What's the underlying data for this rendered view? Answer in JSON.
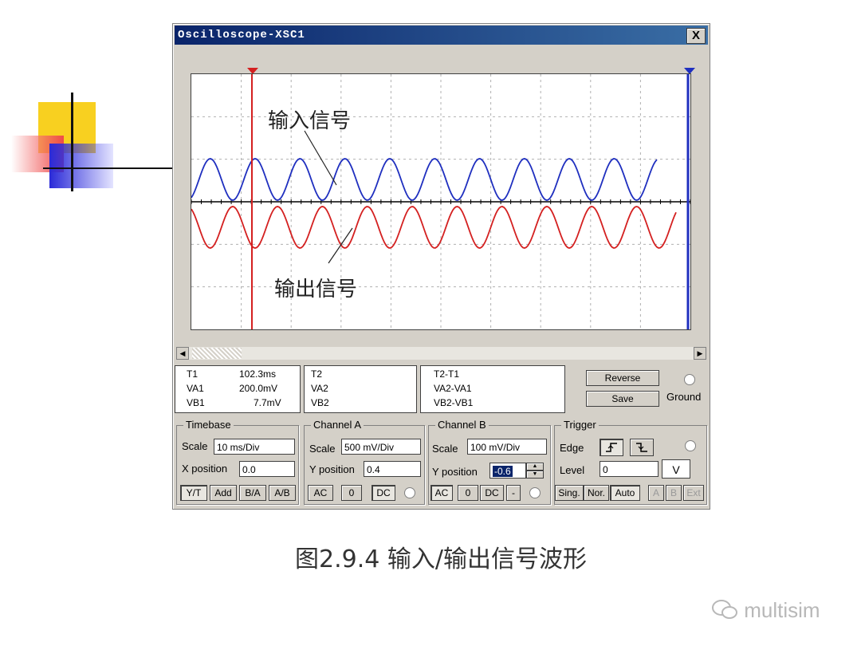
{
  "window": {
    "title": "Oscilloscope-XSC1",
    "close_label": "X"
  },
  "annotations": {
    "input": "输入信号",
    "output": "输出信号"
  },
  "cursor": {
    "t1_label": "T1",
    "va1_label": "VA1",
    "vb1_label": "VB1",
    "t1_value": "102.3ms",
    "va1_value": "200.0mV",
    "vb1_value": "7.7mV",
    "t2_label": "T2",
    "va2_label": "VA2",
    "vb2_label": "VB2",
    "t21_label": "T2-T1",
    "va21_label": "VA2-VA1",
    "vb21_label": "VB2-VB1"
  },
  "actions": {
    "reverse": "Reverse",
    "save": "Save",
    "ground": "Ground"
  },
  "timebase": {
    "title": "Timebase",
    "scale_label": "Scale",
    "scale": "10 ms/Div",
    "xpos_label": "X position",
    "xpos": "0.0",
    "modes": [
      "Y/T",
      "Add",
      "B/A",
      "A/B"
    ]
  },
  "channel_a": {
    "title": "Channel A",
    "scale_label": "Scale",
    "scale": "500 mV/Div",
    "ypos_label": "Y position",
    "ypos": "0.4",
    "coupling": [
      "AC",
      "0",
      "DC"
    ]
  },
  "channel_b": {
    "title": "Channel B",
    "scale_label": "Scale",
    "scale": "100 mV/Div",
    "ypos_label": "Y position",
    "ypos": "-0.6",
    "coupling": [
      "AC",
      "0",
      "DC",
      "-"
    ]
  },
  "trigger": {
    "title": "Trigger",
    "edge_label": "Edge",
    "level_label": "Level",
    "level": "0",
    "unit": "V",
    "modes": [
      "Sing.",
      "Nor.",
      "Auto"
    ],
    "sources": [
      "A",
      "B",
      "Ext"
    ]
  },
  "caption": "图2.9.4  输入/输出信号波形",
  "watermark": "multisim",
  "colors": {
    "channel_a": "#1f2fbf",
    "channel_b": "#d42020",
    "titlebar": "#0a246a"
  }
}
